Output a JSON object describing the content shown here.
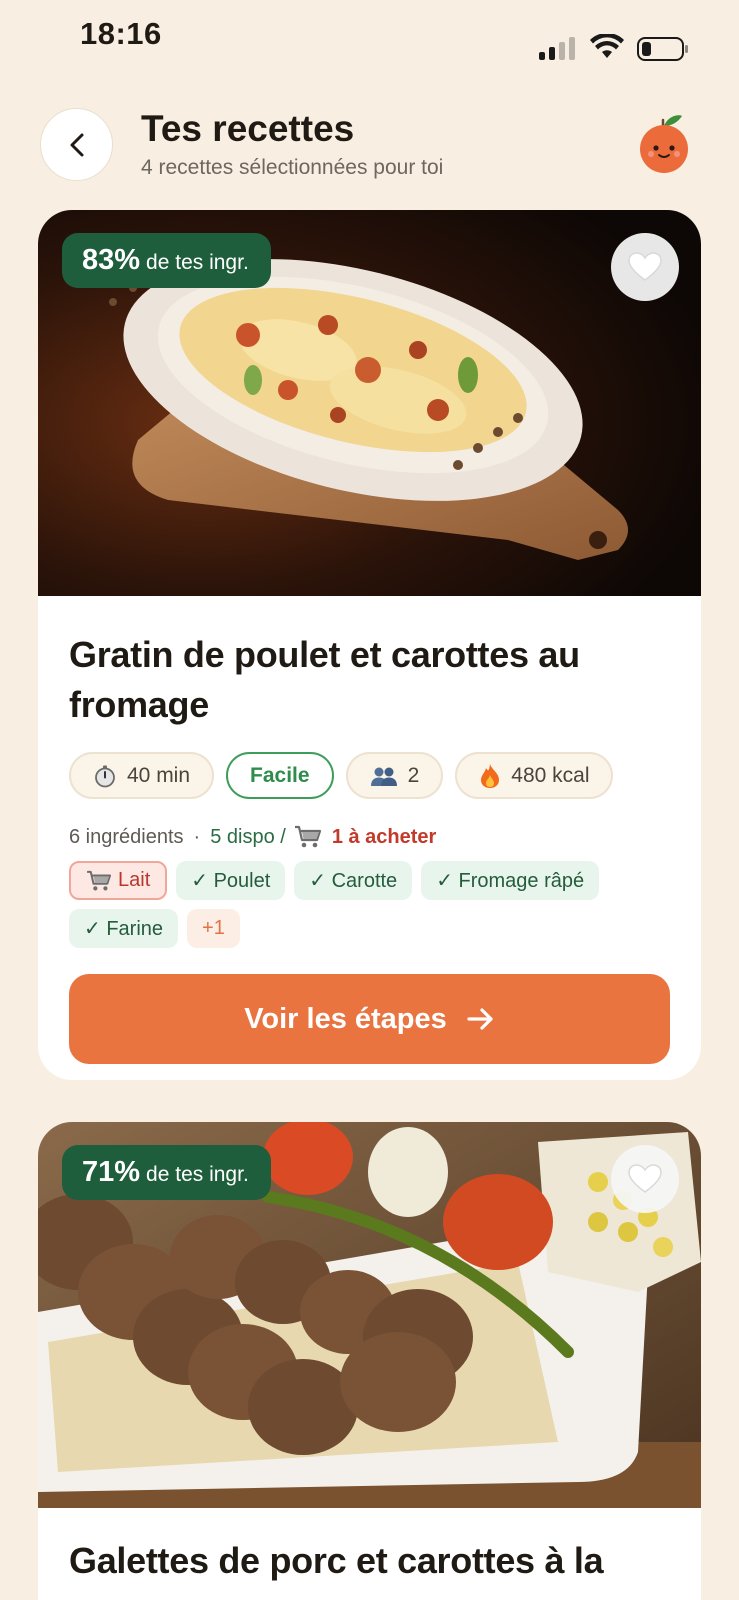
{
  "status_bar": {
    "time": "18:16"
  },
  "header": {
    "title": "Tes recettes",
    "subtitle": "4 recettes sélectionnées pour toi"
  },
  "recipes": [
    {
      "match_pct": "83%",
      "match_label": "de tes ingr.",
      "title": "Gratin de poulet et carottes au fromage",
      "time": "40 min",
      "difficulty": "Facile",
      "servings": "2",
      "calories": "480 kcal",
      "ingredients_count": "6 ingrédients",
      "available": "5 dispo /",
      "to_buy": "1 à acheter",
      "missing_ingredients": [
        "Lait"
      ],
      "available_ingredients": [
        "✓ Poulet",
        "✓ Carotte",
        "✓ Fromage râpé",
        "✓ Farine"
      ],
      "more_count": "+1",
      "cta": "Voir les étapes"
    },
    {
      "match_pct": "71%",
      "match_label": "de tes ingr.",
      "title": "Galettes de porc et carottes à la"
    }
  ],
  "colors": {
    "background": "#f8eee1",
    "accent": "#ea7440",
    "badge_green": "#1e5e3c",
    "missing_red": "#c23a2b"
  },
  "icons": [
    "back-chevron-icon",
    "mascot-orange-icon",
    "heart-icon",
    "stopwatch-icon",
    "people-icon",
    "flame-icon",
    "cart-icon",
    "arrow-right-icon"
  ]
}
